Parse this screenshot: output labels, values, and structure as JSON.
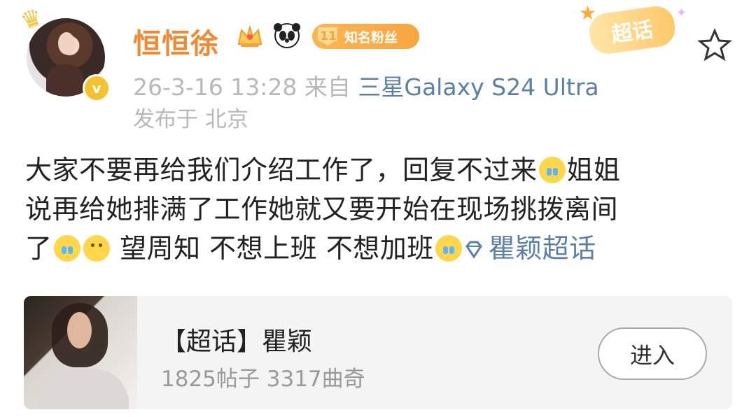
{
  "user": {
    "name": "恒恒徐",
    "fan_badge_level": "11",
    "fan_badge_text": "知名粉丝"
  },
  "header": {
    "supertopic_tag": "超话"
  },
  "meta": {
    "timestamp": "26-3-16 13:28",
    "source_prefix": "来自",
    "device": "三星Galaxy S24 Ultra",
    "location": "发布于 北京"
  },
  "post": {
    "line1_part1": "大家不要再给我们介绍工作了，回复不过来",
    "line1_part2": "姐姐",
    "line2": "说再给她排满了工作她就又要开始在现场挑拨离间",
    "line3_part1": "了",
    "line3_part2": " 望周知 不想上班 不想加班",
    "topic": "瞿颖超话"
  },
  "card": {
    "title": "【超话】瞿颖",
    "stats": "1825帖子 3317曲奇",
    "button_label": "进入"
  },
  "colors": {
    "username": "#f08a32",
    "link": "#5c7fa8",
    "muted": "#b8b8b8",
    "card_bg": "#f4f4f4"
  },
  "icons": {
    "avatar_badge": "verified-icon",
    "vip": "vip-crown-icon",
    "panda": "panda-icon",
    "favorite": "star-outline-icon",
    "emoji_cry": "crying-emoji-icon",
    "emoji_smile": "smile-emoji-icon",
    "topic": "diamond-topic-icon"
  }
}
